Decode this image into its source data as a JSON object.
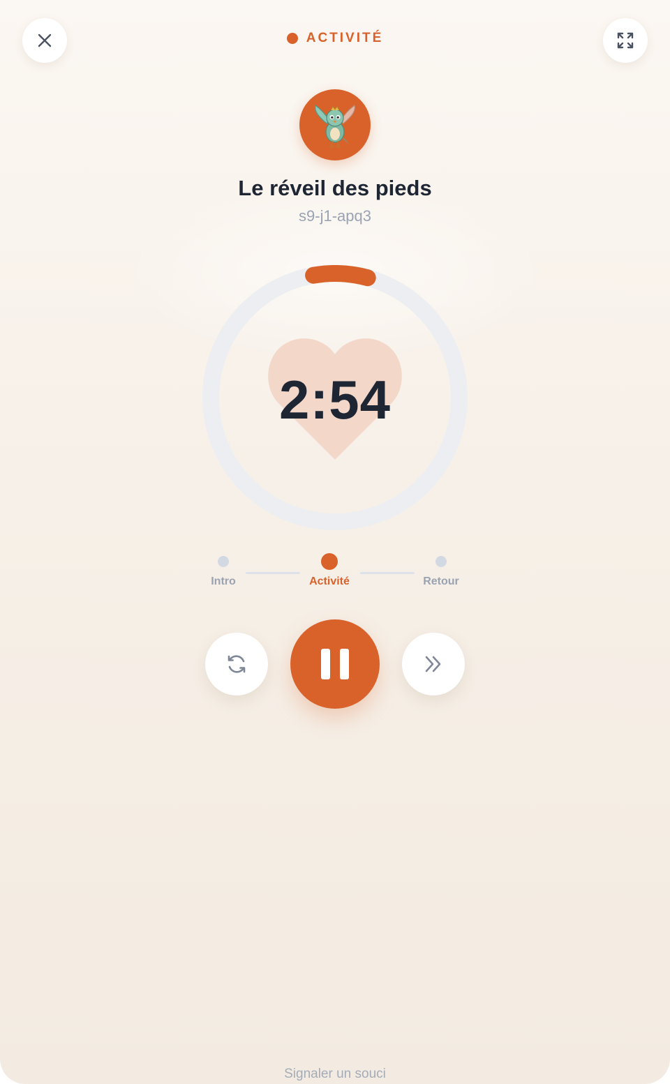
{
  "header": {
    "phase_label": "ACTIVITÉ",
    "close_icon": "close-icon",
    "fullscreen_icon": "fullscreen-icon"
  },
  "activity": {
    "mascot": "bird-mascot",
    "title": "Le réveil des pieds",
    "code": "s9-j1-apq3"
  },
  "timer": {
    "display": "2:54",
    "progress": 0.07,
    "center_icon": "heart-icon"
  },
  "steps": [
    {
      "label": "Intro",
      "active": false
    },
    {
      "label": "Activité",
      "active": true
    },
    {
      "label": "Retour",
      "active": false
    }
  ],
  "controls": {
    "restart_icon": "restart-icon",
    "pause_icon": "pause-icon",
    "skip_icon": "skip-icon"
  },
  "footer": {
    "report_label": "Signaler un souci"
  },
  "colors": {
    "accent": "#d9622b",
    "text_dark": "#1e2533",
    "text_muted": "#9aa3b2",
    "track": "#eceef1",
    "heart": "#f3d8ca"
  }
}
